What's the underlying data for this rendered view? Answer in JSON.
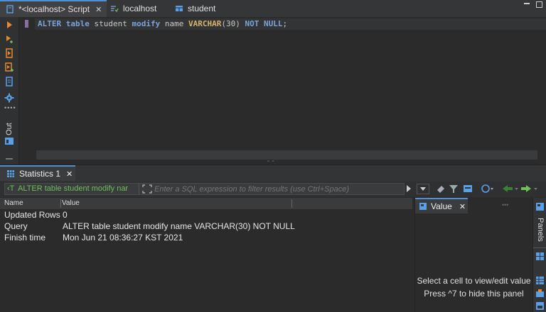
{
  "tabs": [
    {
      "label": "*<localhost> Script",
      "close": "✕"
    },
    {
      "label": "localhost"
    },
    {
      "label": "student"
    }
  ],
  "editor": {
    "tokens": [
      {
        "text": "ALTER",
        "kind": "kw"
      },
      {
        "text": " ",
        "kind": "nm"
      },
      {
        "text": "table",
        "kind": "kw"
      },
      {
        "text": " student ",
        "kind": "nm"
      },
      {
        "text": "modify",
        "kind": "kw"
      },
      {
        "text": " name ",
        "kind": "nm"
      },
      {
        "text": "VARCHAR",
        "kind": "fn"
      },
      {
        "text": "(30) ",
        "kind": "nm"
      },
      {
        "text": "NOT",
        "kind": "kw"
      },
      {
        "text": " ",
        "kind": "nm"
      },
      {
        "text": "NULL",
        "kind": "kw"
      },
      {
        "text": ";",
        "kind": "nm"
      }
    ]
  },
  "left_toolbar": {
    "out_label": "Out"
  },
  "results": {
    "tab_label": "Statistics 1",
    "close": "✕",
    "query_chip": "ALTER table student modify nar",
    "filter_placeholder": "Enter a SQL expression to filter results (use Ctrl+Space)",
    "columns": [
      "Name",
      "Value"
    ],
    "rows": [
      {
        "name": "Updated Rows",
        "value": "0"
      },
      {
        "name": "Query",
        "value": "ALTER table student modify name VARCHAR(30) NOT NULL"
      },
      {
        "name": "Finish time",
        "value": "Mon Jun 21 08:36:27 KST 2021"
      }
    ]
  },
  "value_panel": {
    "tab_label": "Value",
    "close": "✕",
    "hint1": "Select a cell to view/edit value",
    "hint2": "Press ^7 to hide this panel",
    "side_label": "Panels"
  },
  "colors": {
    "accent": "#4f8fd6",
    "keyword": "#7aa3d9",
    "function": "#d7b36b",
    "run": "#e38b2c",
    "chip": "#6fbf5a"
  }
}
